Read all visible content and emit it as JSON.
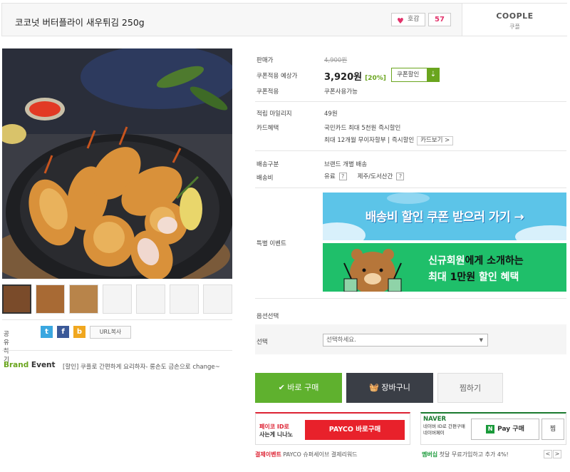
{
  "header": {
    "title": "코코넛 버터플라이 새우튀김 250g",
    "like_label": "호감",
    "like_count": "57",
    "brand_name": "COOPLE",
    "brand_sub": "쿠플"
  },
  "share": {
    "label": "공유하기",
    "url_copy": "URL복사"
  },
  "brand_event": {
    "title_a": "Brand",
    "title_b": " Event",
    "text": "[할인] 쿠플로 간편하게 요리하자- 롱손도 금손으로 change~"
  },
  "info": {
    "rows": [
      {
        "label": "판매가",
        "value": "4,900원"
      },
      {
        "label": "쿠폰적용 예상가",
        "value": "3,920원",
        "pct": "[20%]"
      },
      {
        "label": "쿠폰적용",
        "value": "쿠폰사용가능"
      },
      {
        "label": "적립 마일리지",
        "value": "49원"
      },
      {
        "label": "카드혜택",
        "value": "국민카드 최대 5천원 즉시할인",
        "value2": "최대 12개월 무이자할부 | 즉시할인",
        "card_btn": "카드보기 >"
      },
      {
        "label": "배송구분",
        "value": "브랜드 개별 배송"
      },
      {
        "label": "배송비",
        "value": "유료",
        "value2": "제주/도서산간"
      },
      {
        "label": "특별 이벤트"
      }
    ],
    "coupon_btn": "쿠폰할인",
    "help_mark": "?"
  },
  "banners": {
    "delivery": "배송비 할인 쿠폰 받으러 가기 →",
    "member_l1a": "신규회원",
    "member_l1b": "에게 소개하는",
    "member_l2a": "최대 ",
    "member_l2b": "1만원",
    "member_l2c": " 할인 혜택"
  },
  "option": {
    "section": "옵션선택",
    "label": "선택",
    "placeholder": "선택하세요."
  },
  "actions": {
    "buy": "바로 구매",
    "cart": "장바구니",
    "wish": "찜하기"
  },
  "payco": {
    "label_red": "페이코 ID로",
    "label": "사는게 니나노",
    "button": "PAYCO 바로구매",
    "event_label": "결제이벤트",
    "event_text": " PAYCO 슈퍼세이브 결제리워드"
  },
  "naver": {
    "logo": "NAVER",
    "desc1": "네이버 ID로 간편구매",
    "desc2": "네이버페이",
    "button": "Pay 구매",
    "n_mark": "N",
    "wish": "찜",
    "event_label": "멤버십",
    "event_text": " 첫달 무료가입하고 추가 4%!",
    "prev": "<",
    "next": ">"
  },
  "icons": {
    "heart": "heart-icon",
    "check": "check-icon",
    "basket": "basket-icon",
    "download": "download-icon",
    "twitter": "t",
    "facebook": "f",
    "story": "b"
  }
}
